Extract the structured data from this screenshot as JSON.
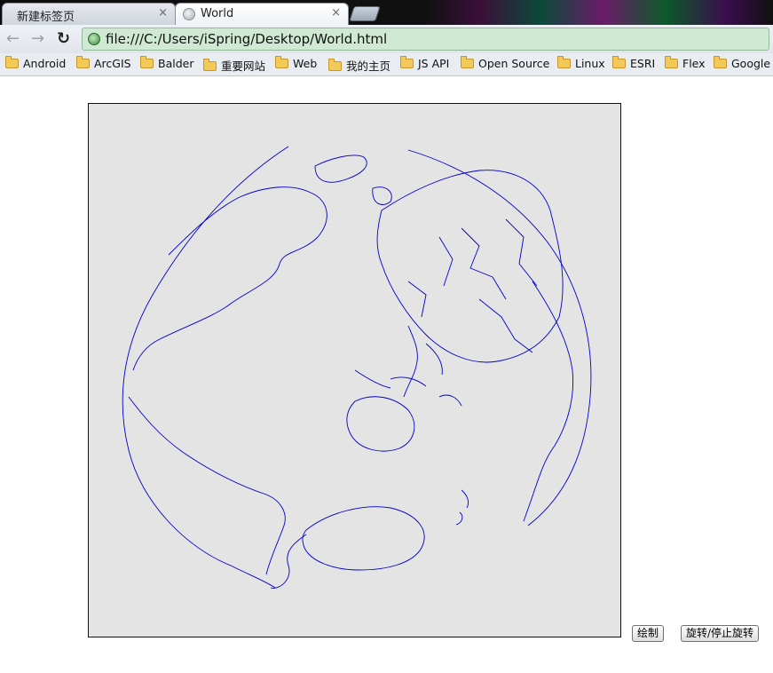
{
  "tabs": [
    {
      "title": "新建标签页",
      "close": "×"
    },
    {
      "title": "World",
      "close": "×"
    }
  ],
  "toolbar": {
    "back": "←",
    "forward": "→",
    "reload": "↻",
    "url": "file:///C:/Users/iSpring/Desktop/World.html"
  },
  "bookmarks": [
    "Android",
    "ArcGIS",
    "Balder",
    "重要网站",
    "Web",
    "我的主页",
    "JS API",
    "Open Source",
    "Linux",
    "ESRI",
    "Flex",
    "Google"
  ],
  "buttons": {
    "draw": "绘制",
    "rotate": "旋转/停止旋转"
  },
  "colors": {
    "coastline": "#0000cc",
    "canvas_bg": "#e4e4e4"
  }
}
